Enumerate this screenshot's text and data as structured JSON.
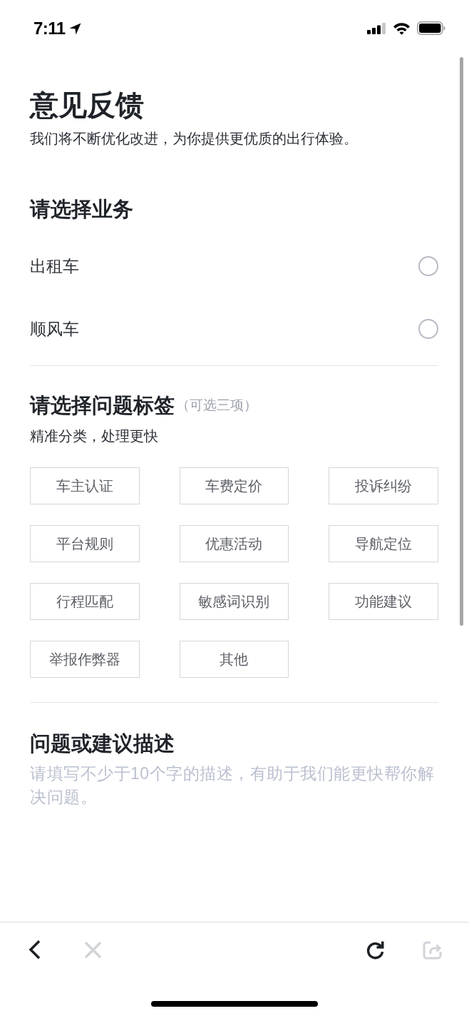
{
  "status_bar": {
    "time": "7:11"
  },
  "header": {
    "title": "意见反馈",
    "subtitle": "我们将不断优化改进，为你提供更优质的出行体验。"
  },
  "business": {
    "heading": "请选择业务",
    "options": [
      {
        "label": "出租车",
        "selected": false
      },
      {
        "label": "顺风车",
        "selected": false
      }
    ]
  },
  "tags": {
    "heading": "请选择问题标签",
    "note": "（可选三项）",
    "subtitle": "精准分类，处理更快",
    "items": [
      {
        "label": "车主认证",
        "selected": false
      },
      {
        "label": "车费定价",
        "selected": false
      },
      {
        "label": "投诉纠纷",
        "selected": false
      },
      {
        "label": "平台规则",
        "selected": false
      },
      {
        "label": "优惠活动",
        "selected": false
      },
      {
        "label": "导航定位",
        "selected": false
      },
      {
        "label": "行程匹配",
        "selected": false
      },
      {
        "label": "敏感词识别",
        "selected": false
      },
      {
        "label": "功能建议",
        "selected": false
      },
      {
        "label": "举报作弊器",
        "selected": false
      },
      {
        "label": "其他",
        "selected": false
      }
    ]
  },
  "description": {
    "heading": "问题或建议描述",
    "placeholder": "请填写不少于10个字的描述，有助于我们能更快帮你解决问题。"
  },
  "toolbar": {
    "back": {
      "disabled": false
    },
    "close": {
      "disabled": true
    },
    "reload": {
      "disabled": false
    },
    "share": {
      "disabled": true
    }
  }
}
